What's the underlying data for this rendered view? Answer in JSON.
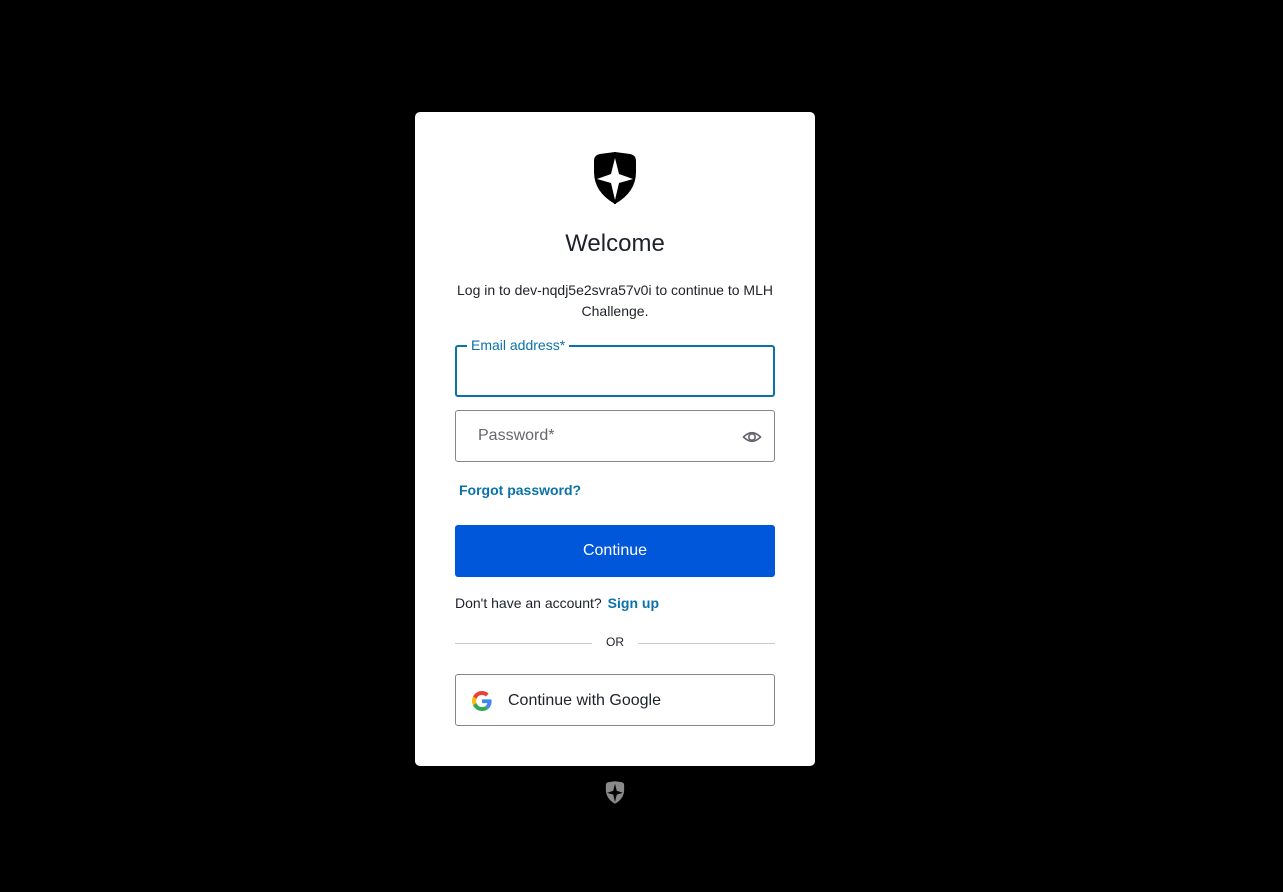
{
  "card": {
    "title": "Welcome",
    "subtitle": "Log in to dev-nqdj5e2svra57v0i to continue to MLH Challenge.",
    "email": {
      "label": "Email address*",
      "value": ""
    },
    "password": {
      "placeholder": "Password*",
      "value": "",
      "toggle_icon": "eye-icon"
    },
    "forgot_password": "Forgot password?",
    "continue_label": "Continue",
    "signup_prompt": "Don't have an account?",
    "signup_link": "Sign up",
    "divider_text": "OR",
    "google_label": "Continue with Google"
  },
  "icons": {
    "logo": "auth0-shield-icon",
    "google": "google-icon",
    "footer": "auth0-shield-icon"
  },
  "colors": {
    "background": "#000000",
    "card": "#ffffff",
    "primary": "#0057d9",
    "link": "#0a72a8",
    "text": "#1e212a"
  }
}
